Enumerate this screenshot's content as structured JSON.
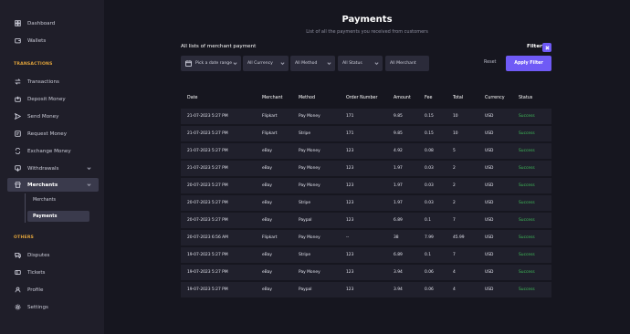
{
  "sidebar": {
    "top_items": [
      {
        "label": "Dashboard",
        "icon": "dashboard-icon"
      },
      {
        "label": "Wallets",
        "icon": "wallet-icon"
      }
    ],
    "transactions_title": "TRANSACTIONS",
    "transaction_items": [
      {
        "label": "Transactions",
        "icon": "transfer-icon"
      },
      {
        "label": "Deposit Money",
        "icon": "deposit-icon"
      },
      {
        "label": "Send Money",
        "icon": "send-icon"
      },
      {
        "label": "Request Money",
        "icon": "request-icon"
      },
      {
        "label": "Exchange Money",
        "icon": "exchange-icon"
      },
      {
        "label": "Withdrawals",
        "icon": "withdrawal-icon"
      },
      {
        "label": "Merchants",
        "icon": "merchant-icon"
      }
    ],
    "merchant_sub_items": [
      {
        "label": "Merchants"
      },
      {
        "label": "Payments"
      }
    ],
    "others_title": "OTHERS",
    "other_items": [
      {
        "label": "Disputes",
        "icon": "disputes-icon"
      },
      {
        "label": "Tickets",
        "icon": "ticket-icon"
      },
      {
        "label": "Profile",
        "icon": "user-icon"
      },
      {
        "label": "Settings",
        "icon": "gear-icon"
      }
    ]
  },
  "header": {
    "title": "Payments",
    "subtitle": "List of all the payments you received from customers"
  },
  "toolbar": {
    "list_label": "All lists of merchant payment",
    "filter_label": "Filter",
    "date_placeholder": "Pick a date range",
    "currency": "All Currency",
    "method": "All Method",
    "status": "All Status",
    "merchant": "All Merchant",
    "reset_label": "Reset",
    "apply_label": "Apply Filter"
  },
  "table": {
    "columns": [
      "Date",
      "Merchant",
      "Method",
      "Order Number",
      "Amount",
      "Fee",
      "Total",
      "Currency",
      "Status"
    ],
    "rows": [
      [
        "21-07-2023 5:27 PM",
        "Flipkart",
        "Pay Money",
        "171",
        "9.85",
        "0.15",
        "10",
        "USD",
        "Success"
      ],
      [
        "21-07-2023 5:27 PM",
        "Flipkart",
        "Stripe",
        "171",
        "9.85",
        "0.15",
        "10",
        "USD",
        "Success"
      ],
      [
        "21-07-2023 5:27 PM",
        "eBay",
        "Pay Money",
        "123",
        "4.92",
        "0.08",
        "5",
        "USD",
        "Success"
      ],
      [
        "21-07-2023 5:27 PM",
        "eBay",
        "Pay Money",
        "123",
        "1.97",
        "0.03",
        "2",
        "USD",
        "Success"
      ],
      [
        "20-07-2023 5:27 PM",
        "eBay",
        "Pay Money",
        "123",
        "1.97",
        "0.03",
        "2",
        "USD",
        "Success"
      ],
      [
        "20-07-2023 5:27 PM",
        "eBay",
        "Stripe",
        "123",
        "1.97",
        "0.03",
        "2",
        "USD",
        "Success"
      ],
      [
        "20-07-2023 5:27 PM",
        "eBay",
        "Paypal",
        "123",
        "6.89",
        "0.1",
        "7",
        "USD",
        "Success"
      ],
      [
        "20-07-2023 6:56 AM",
        "Flipkart",
        "Pay Money",
        "--",
        "38",
        "7.99",
        "45.99",
        "USD",
        "Success"
      ],
      [
        "19-07-2023 5:27 PM",
        "eBay",
        "Stripe",
        "123",
        "6.89",
        "0.1",
        "7",
        "USD",
        "Success"
      ],
      [
        "19-07-2023 5:27 PM",
        "eBay",
        "Pay Money",
        "123",
        "3.94",
        "0.06",
        "4",
        "USD",
        "Success"
      ],
      [
        "19-07-2023 5:27 PM",
        "eBay",
        "Paypal",
        "123",
        "3.94",
        "0.06",
        "4",
        "USD",
        "Success"
      ]
    ]
  },
  "colors": {
    "accent": "#6f5af6",
    "section_title": "#e0a33b",
    "success": "#3fbf5a",
    "sidebar_bg": "#1f1e29",
    "main_bg": "#16161f",
    "row_bg": "#20202c"
  }
}
